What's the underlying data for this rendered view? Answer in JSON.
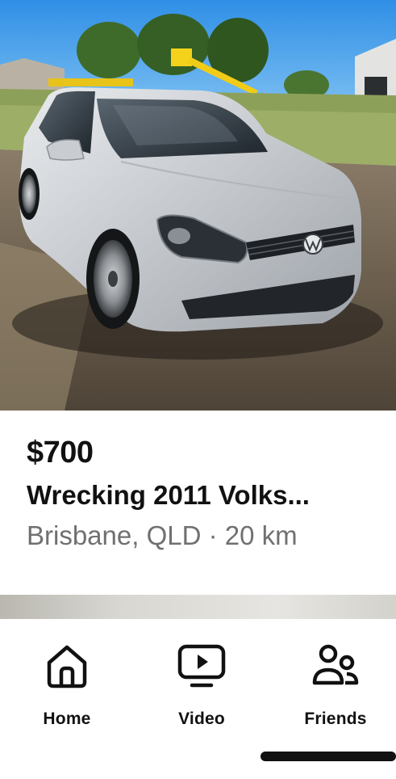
{
  "listing": {
    "price": "$700",
    "title": "Wrecking 2011 Volks...",
    "location": "Brisbane, QLD · 20 km"
  },
  "nav": {
    "items": [
      {
        "label": "Home",
        "icon": "home-icon"
      },
      {
        "label": "Video",
        "icon": "video-icon"
      },
      {
        "label": "Friends",
        "icon": "friends-icon"
      }
    ]
  },
  "colors": {
    "text_primary": "#111111",
    "text_secondary": "#707070",
    "background": "#ffffff"
  }
}
